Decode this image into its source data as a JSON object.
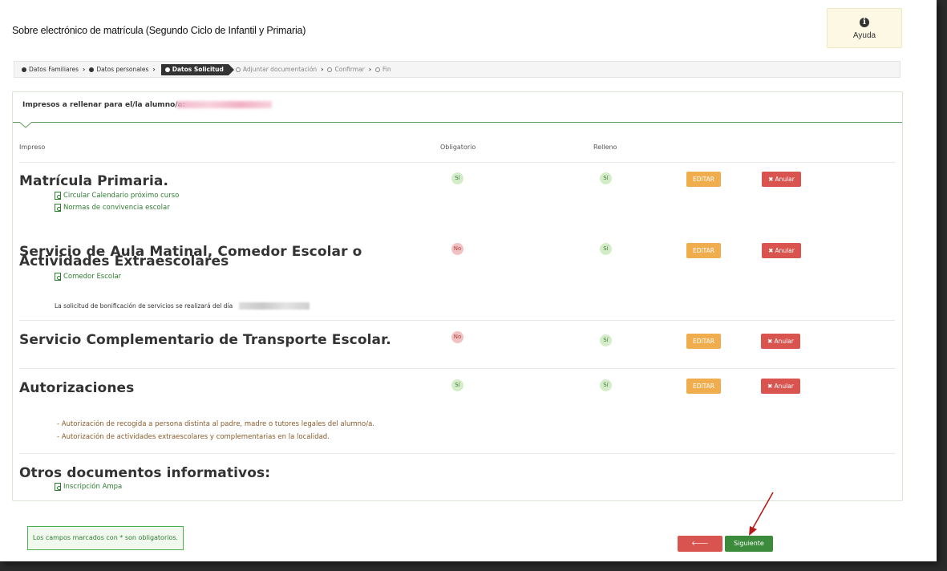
{
  "page": {
    "title": "Sobre electrónico de matrícula (Segundo Ciclo de Infantil y Primaria)"
  },
  "help": {
    "icon": "info-circle-icon",
    "label": "Ayuda"
  },
  "breadcrumb": {
    "steps": [
      {
        "label": "Datos Familiares",
        "state": "done"
      },
      {
        "label": "Datos personales",
        "state": "done"
      },
      {
        "label": "Datos Solicitud",
        "state": "active"
      },
      {
        "label": "Adjuntar documentación",
        "state": "todo"
      },
      {
        "label": "Confirmar",
        "state": "todo"
      },
      {
        "label": "Fin",
        "state": "todo"
      }
    ]
  },
  "panel": {
    "heading": "Impresos a rellenar para el/la alumno/a:",
    "columns": {
      "impreso": "Impreso",
      "obligatorio": "Obligatorio",
      "relleno": "Relleno"
    }
  },
  "rows": [
    {
      "title": "Matrícula Primaria.",
      "obligatorio": "Sí",
      "relleno": "Sí",
      "links": [
        "Circular Calendario próximo curso",
        "Normas de convivencia escolar"
      ]
    },
    {
      "title_line1": "Servicio de Aula Matinal, Comedor Escolar o",
      "title_line2": "Actividades Extraescolares",
      "obligatorio": "No",
      "relleno": "Sí",
      "links": [
        "Comedor Escolar"
      ],
      "note": "La solicitud de bonificación de servicios se realizará del día"
    },
    {
      "title": "Servicio Complementario de Transporte Escolar.",
      "obligatorio": "No",
      "relleno": "Sí"
    },
    {
      "title": "Autorizaciones",
      "obligatorio": "Sí",
      "relleno": "Sí",
      "items": [
        "- Autorización de recogida a persona distinta al padre, madre o tutores legales del alumno/a.",
        "- Autorización de actividades extraescolares y complementarias en la localidad."
      ]
    },
    {
      "title": "Otros documentos informativos:",
      "links": [
        "Inscripción Ampa"
      ]
    }
  ],
  "actions": {
    "edit": "EDITAR",
    "cancel": "Anular"
  },
  "footer": {
    "required_note": "Los campos marcados con * son obligatorios.",
    "prev": "Anterior",
    "next": "Siguiente"
  },
  "colors": {
    "green": "#3c8a3c",
    "red": "#d9534f",
    "orange": "#f0ad4e"
  }
}
